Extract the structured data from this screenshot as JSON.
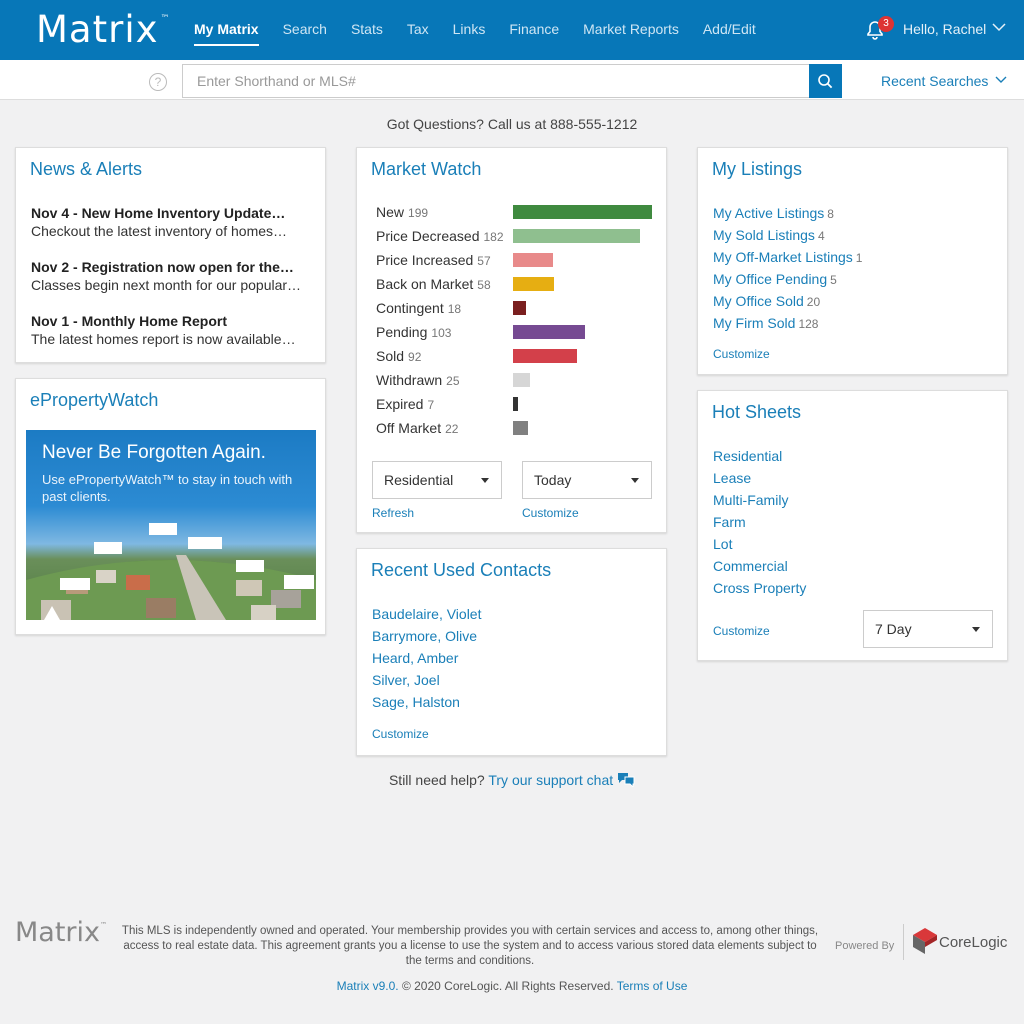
{
  "app": {
    "logo": "Matrix",
    "logo_tm": "™"
  },
  "nav": {
    "items": [
      {
        "label": "My Matrix",
        "active": true
      },
      {
        "label": "Search"
      },
      {
        "label": "Stats"
      },
      {
        "label": "Tax"
      },
      {
        "label": "Links"
      },
      {
        "label": "Finance"
      },
      {
        "label": "Market Reports"
      },
      {
        "label": "Add/Edit"
      }
    ]
  },
  "user": {
    "notification_count": "3",
    "greeting": "Hello, Rachel"
  },
  "search": {
    "placeholder": "Enter Shorthand or MLS#",
    "help": "?",
    "recent_label": "Recent Searches"
  },
  "questions": "Got Questions? Call us at 888-555-1212",
  "news": {
    "title": "News & Alerts",
    "items": [
      {
        "headline": "Nov 4 - New Home Inventory Update…",
        "body": "Checkout the latest inventory of homes…"
      },
      {
        "headline": "Nov 2 - Registration now open for the…",
        "body": "Classes begin next month for our popular…"
      },
      {
        "headline": "Nov 1 - Monthly Home Report",
        "body": "The latest homes report is now available…"
      }
    ]
  },
  "eproperty": {
    "title": "ePropertyWatch",
    "banner_title": "Never Be Forgotten Again.",
    "banner_sub": "Use ePropertyWatch™ to stay in touch with past clients."
  },
  "market_watch": {
    "title": "Market Watch",
    "rows": [
      {
        "label": "New",
        "count": "199",
        "value": 199,
        "color": "#3f8a3f"
      },
      {
        "label": "Price Decreased",
        "count": "182",
        "value": 182,
        "color": "#8fbf8f"
      },
      {
        "label": "Price Increased",
        "count": "57",
        "value": 57,
        "color": "#e88a8a"
      },
      {
        "label": "Back on Market",
        "count": "58",
        "value": 58,
        "color": "#e6ae12"
      },
      {
        "label": "Contingent",
        "count": "18",
        "value": 18,
        "color": "#7a1f1f"
      },
      {
        "label": "Pending",
        "count": "103",
        "value": 103,
        "color": "#764a92"
      },
      {
        "label": "Sold",
        "count": "92",
        "value": 92,
        "color": "#d3404a"
      },
      {
        "label": "Withdrawn",
        "count": "25",
        "value": 25,
        "color": "#d6d6d6"
      },
      {
        "label": "Expired",
        "count": "7",
        "value": 7,
        "color": "#333333"
      },
      {
        "label": "Off Market",
        "count": "22",
        "value": 22,
        "color": "#808080"
      }
    ],
    "max": 199,
    "type_select": "Residential",
    "period_select": "Today",
    "refresh": "Refresh",
    "customize": "Customize"
  },
  "contacts": {
    "title": "Recent Used Contacts",
    "items": [
      "Baudelaire, Violet",
      "Barrymore, Olive",
      "Heard, Amber",
      "Silver, Joel",
      "Sage, Halston"
    ],
    "customize": "Customize"
  },
  "my_listings": {
    "title": "My Listings",
    "items": [
      {
        "label": "My Active Listings",
        "count": "8"
      },
      {
        "label": "My Sold Listings",
        "count": "4"
      },
      {
        "label": "My Off-Market Listings",
        "count": "1"
      },
      {
        "label": "My Office Pending",
        "count": "5"
      },
      {
        "label": "My Office Sold",
        "count": "20"
      },
      {
        "label": "My Firm Sold",
        "count": "128"
      }
    ],
    "customize": "Customize"
  },
  "hot_sheets": {
    "title": "Hot Sheets",
    "items": [
      "Residential",
      "Lease",
      "Multi-Family",
      "Farm",
      "Lot",
      "Commercial",
      "Cross Property"
    ],
    "customize": "Customize",
    "period_select": "7 Day"
  },
  "support": {
    "prefix": "Still need help?",
    "link": "Try our support chat"
  },
  "footer": {
    "logo": "Matrix",
    "logo_tm": "™",
    "disclaimer": "This MLS is independently owned and operated. Your membership provides you with certain services and access to, among other things, access to real estate data. This agreement grants you a license to use the system and to access various stored data elements subject to the terms and conditions.",
    "powered_by": "Powered By",
    "brand": "CoreLogic",
    "version": "Matrix v9.0.",
    "copyright": "© 2020 CoreLogic. All Rights Reserved.",
    "terms": "Terms of Use"
  },
  "colors": {
    "brand": "#0777b8",
    "link": "#1a7fb8",
    "badge": "#dd3333"
  }
}
